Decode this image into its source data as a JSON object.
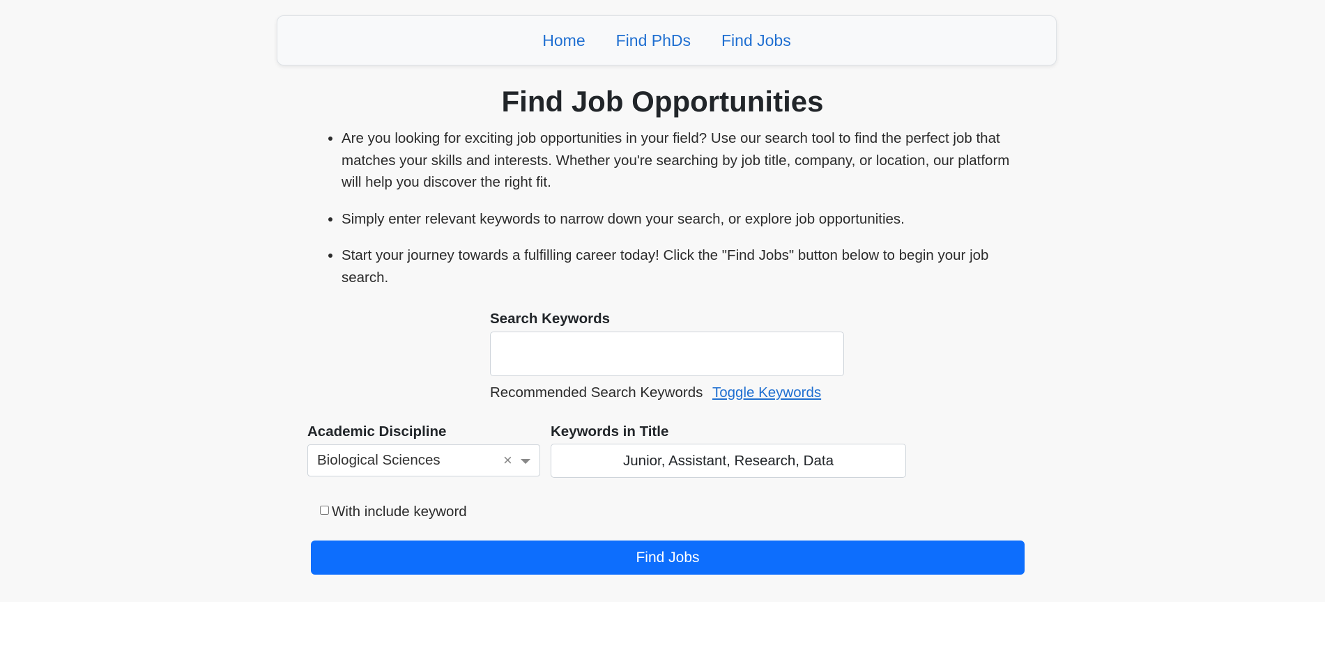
{
  "nav": {
    "items": [
      {
        "label": "Home"
      },
      {
        "label": "Find PhDs"
      },
      {
        "label": "Find Jobs"
      }
    ]
  },
  "page": {
    "title": "Find Job Opportunities",
    "intro": [
      "Are you looking for exciting job opportunities in your field? Use our search tool to find the perfect job that matches your skills and interests. Whether you're searching by job title, company, or location, our platform will help you discover the right fit.",
      "Simply enter relevant keywords to narrow down your search, or explore job opportunities.",
      "Start your journey towards a fulfilling career today! Click the \"Find Jobs\" button below to begin your job search."
    ]
  },
  "search": {
    "label": "Search Keywords",
    "value": "",
    "recommended_text": "Recommended Search Keywords",
    "toggle_label": "Toggle Keywords"
  },
  "discipline": {
    "label": "Academic Discipline",
    "selected": "Biological Sciences",
    "clear_glyph": "×"
  },
  "title_keywords": {
    "label": "Keywords in Title",
    "value": "Junior, Assistant, Research, Data"
  },
  "include_keyword": {
    "label": "With include keyword",
    "checked": false
  },
  "submit": {
    "label": "Find Jobs"
  },
  "colors": {
    "accent": "#0d6efd",
    "link": "#1f6fd1",
    "background": "#f8f8f8"
  }
}
